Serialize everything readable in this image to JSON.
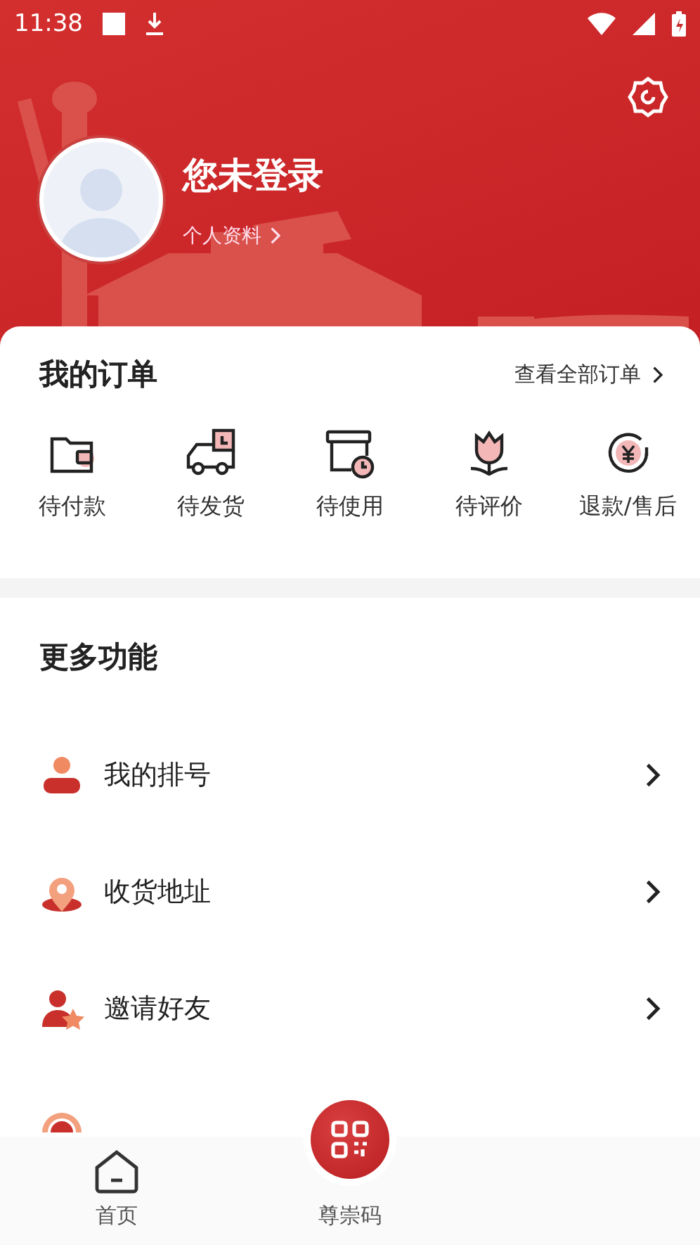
{
  "status_bar": {
    "time": "11:38"
  },
  "profile": {
    "name": "您未登录",
    "link": "个人资料"
  },
  "orders": {
    "title": "我的订单",
    "view_all": "查看全部订单",
    "items": [
      {
        "label": "待付款",
        "kind": "wallet"
      },
      {
        "label": "待发货",
        "kind": "truck"
      },
      {
        "label": "待使用",
        "kind": "box"
      },
      {
        "label": "待评价",
        "kind": "flower"
      },
      {
        "label": "退款/售后",
        "kind": "refund"
      }
    ]
  },
  "more": {
    "title": "更多功能",
    "items": [
      {
        "label": "我的排号",
        "kind": "person"
      },
      {
        "label": "收货地址",
        "kind": "pin"
      },
      {
        "label": "邀请好友",
        "kind": "invite"
      },
      {
        "kind": "service"
      }
    ]
  },
  "nav": {
    "items": [
      {
        "label": "首页",
        "kind": "home"
      },
      {
        "label": "尊崇码",
        "kind": "qr"
      }
    ]
  }
}
